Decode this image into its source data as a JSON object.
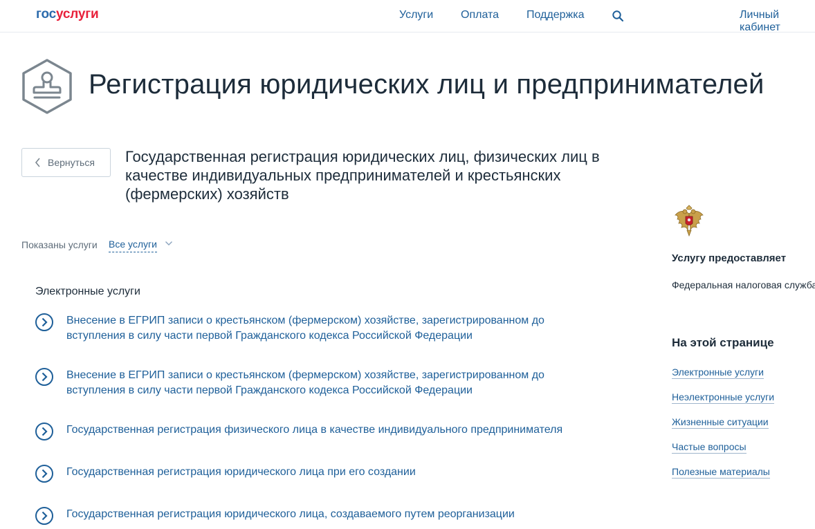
{
  "header": {
    "logo_part1": "гос",
    "logo_part2": "услуги",
    "nav": [
      {
        "label": "Услуги"
      },
      {
        "label": "Оплата"
      },
      {
        "label": "Поддержка"
      }
    ],
    "account_label": "Личный кабинет"
  },
  "page": {
    "title": "Регистрация юридических лиц и предпринимателей",
    "back_label": "Вернуться",
    "service_title": "Государственная регистрация юридических лиц, физических лиц в качестве индивидуальных предпринимателей и крестьянских (фермерских) хозяйств"
  },
  "filter": {
    "label": "Показаны услуги",
    "selected": "Все услуги"
  },
  "services": {
    "heading": "Электронные услуги",
    "items": [
      {
        "label": "Внесение в ЕГРИП записи о крестьянском (фермерском) хозяйстве, зарегистрированном до вступления в силу части первой Гражданского кодекса Российской Федерации"
      },
      {
        "label": "Внесение в ЕГРИП записи о крестьянском (фермерском) хозяйстве, зарегистрированном до вступления в силу части первой Гражданского кодекса Российской Федерации"
      },
      {
        "label": "Государственная регистрация физического лица в качестве индивидуального предпринимателя"
      },
      {
        "label": "Государственная регистрация юридического лица при его создании"
      },
      {
        "label": "Государственная регистрация юридического лица, создаваемого путем реорганизации"
      }
    ]
  },
  "sidebar": {
    "provider_heading": "Услугу предоставляет",
    "provider_name": "Федеральная налоговая служба",
    "onpage_heading": "На этой странице",
    "links": [
      {
        "label": "Электронные услуги"
      },
      {
        "label": "Неэлектронные услуги"
      },
      {
        "label": "Жизненные ситуации"
      },
      {
        "label": "Частые вопросы"
      },
      {
        "label": "Полезные материалы"
      }
    ]
  },
  "colors": {
    "link": "#1e5f99",
    "text": "#1d2c3a",
    "logo_blue": "#2b6aac",
    "logo_red": "#e8203a"
  }
}
